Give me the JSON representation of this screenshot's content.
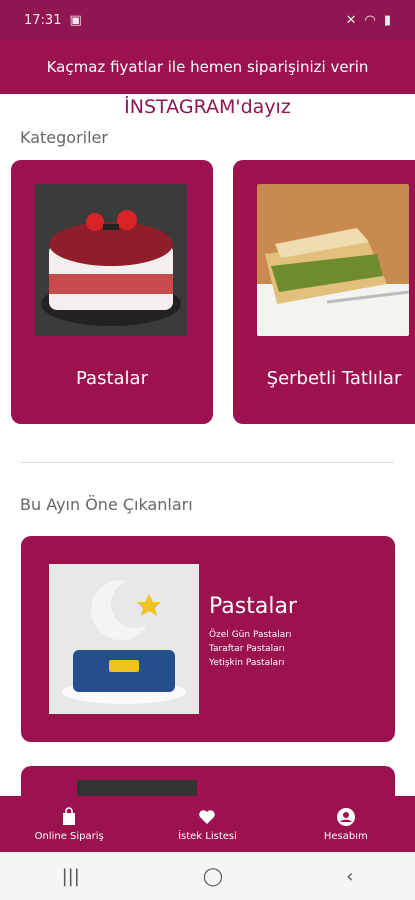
{
  "status_bar": {
    "time": "17:31",
    "icons": [
      "mute-icon",
      "wifi-icon",
      "battery-icon"
    ]
  },
  "header": {
    "text": "Kaçmaz fiyatlar ile hemen siparişinizi verin"
  },
  "instagram": {
    "text": "İNSTAGRAM'dayız"
  },
  "categories": {
    "title": "Kategoriler",
    "items": [
      {
        "label": "Pastalar",
        "image": "red-velvet-cake"
      },
      {
        "label": "Şerbetli Tatlılar",
        "image": "pistachio-baklava"
      }
    ]
  },
  "featured": {
    "title": "Bu Ayın Öne Çıkanları",
    "items": [
      {
        "title": "Pastalar",
        "lines": [
          "Özel Gün Pastaları",
          "Taraftar Pastaları",
          "Yetişkin Pastaları"
        ],
        "image": "moon-theme-cake"
      }
    ]
  },
  "bottom_nav": {
    "items": [
      {
        "label": "Online Sipariş",
        "icon": "shopping-bag-icon"
      },
      {
        "label": "İstek Listesi",
        "icon": "heart-icon"
      },
      {
        "label": "Hesabım",
        "icon": "account-icon"
      }
    ]
  },
  "colors": {
    "primary": "#9b124f",
    "status_bar": "#8f1650",
    "page_bg": "#ffffff"
  }
}
